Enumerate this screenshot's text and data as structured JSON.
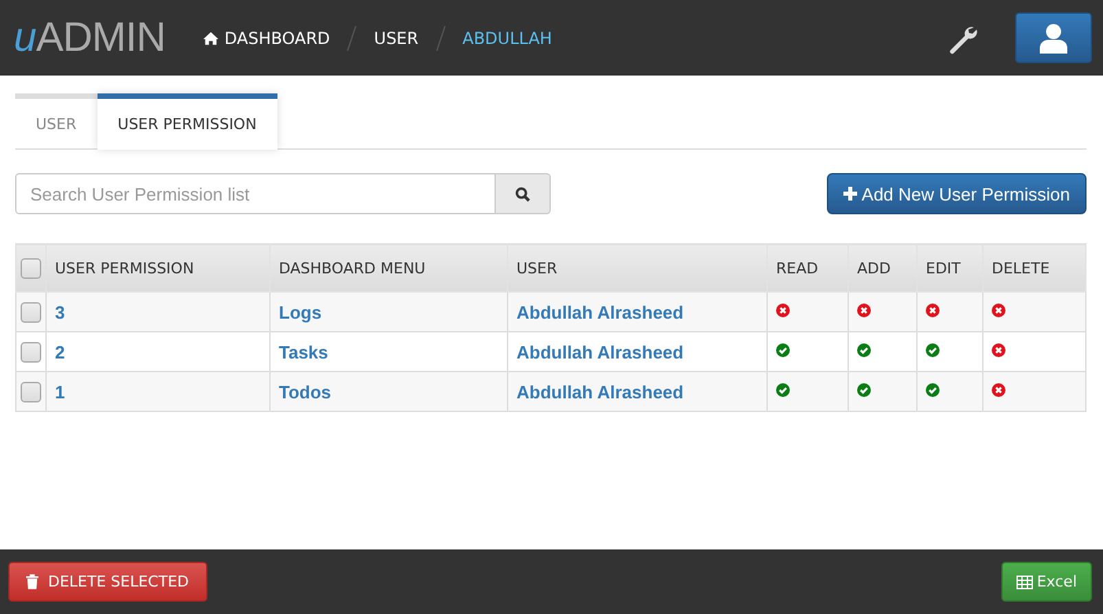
{
  "header": {
    "logo": {
      "mark": "u",
      "text": "ADMIN"
    },
    "breadcrumbs": [
      {
        "label": "DASHBOARD",
        "kind": "home",
        "selected": false
      },
      {
        "label": "USER",
        "kind": "plain",
        "selected": false
      },
      {
        "label": "ABDULLAH",
        "kind": "plain",
        "selected": true
      }
    ]
  },
  "tabs": [
    {
      "label": "USER",
      "selected": false
    },
    {
      "label": "USER PERMISSION",
      "selected": true
    }
  ],
  "search": {
    "placeholder": "Search User Permission list"
  },
  "add_button": "Add New User Permission",
  "table": {
    "select_all": false,
    "columns": [
      "USER PERMISSION",
      "DASHBOARD MENU",
      "USER",
      "READ",
      "ADD",
      "EDIT",
      "DELETE"
    ],
    "rows": [
      {
        "checked": false,
        "id": "3",
        "menu": "Logs",
        "user": "Abdullah Alrasheed",
        "read": false,
        "add": false,
        "edit": false,
        "delete": false
      },
      {
        "checked": false,
        "id": "2",
        "menu": "Tasks",
        "user": "Abdullah Alrasheed",
        "read": true,
        "add": true,
        "edit": true,
        "delete": false
      },
      {
        "checked": false,
        "id": "1",
        "menu": "Todos",
        "user": "Abdullah Alrasheed",
        "read": true,
        "add": true,
        "edit": true,
        "delete": false
      }
    ]
  },
  "footer": {
    "delete_button": "DELETE SELECTED",
    "excel_button": "Excel"
  }
}
